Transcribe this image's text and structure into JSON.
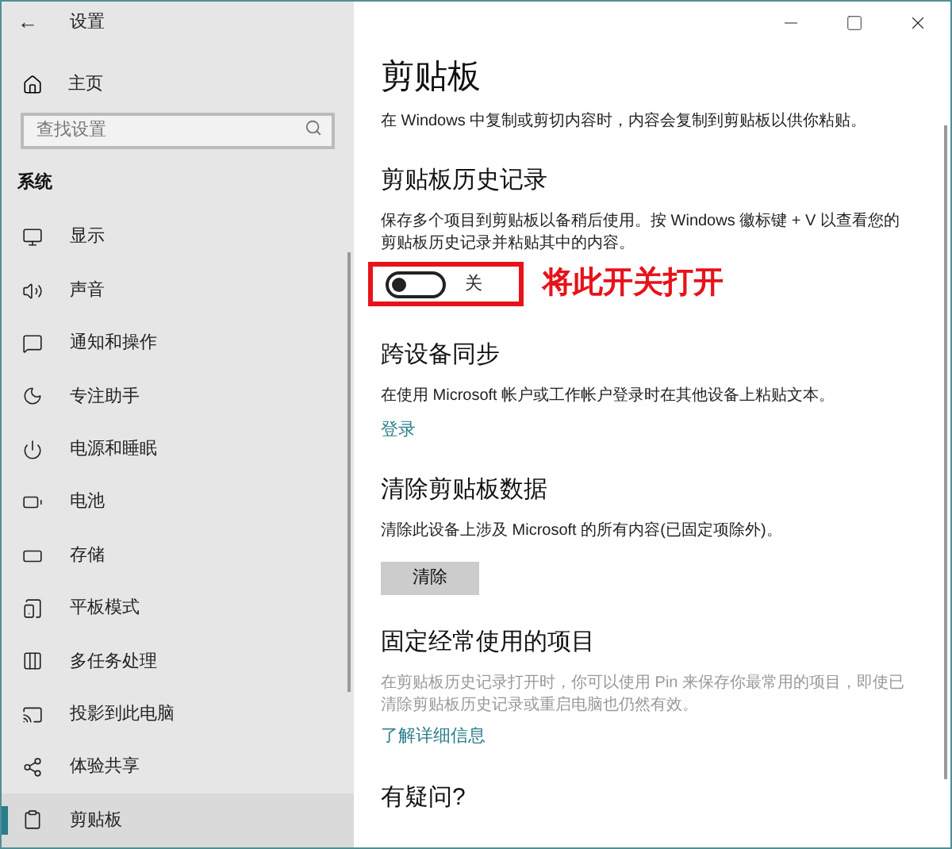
{
  "window": {
    "title": "设置",
    "back": "←"
  },
  "sidebar": {
    "home": "主页",
    "search": {
      "placeholder": "查找设置"
    },
    "section": "系统",
    "items": [
      {
        "label": "显示",
        "selected": false
      },
      {
        "label": "声音",
        "selected": false
      },
      {
        "label": "通知和操作",
        "selected": false
      },
      {
        "label": "专注助手",
        "selected": false
      },
      {
        "label": "电源和睡眠",
        "selected": false
      },
      {
        "label": "电池",
        "selected": false
      },
      {
        "label": "存储",
        "selected": false
      },
      {
        "label": "平板模式",
        "selected": false
      },
      {
        "label": "多任务处理",
        "selected": false
      },
      {
        "label": "投影到此电脑",
        "selected": false
      },
      {
        "label": "体验共享",
        "selected": false
      },
      {
        "label": "剪贴板",
        "selected": true
      }
    ]
  },
  "page": {
    "title": "剪贴板",
    "intro": "在 Windows 中复制或剪切内容时，内容会复制到剪贴板以供你粘贴。",
    "sections": [
      {
        "kind": "toggle",
        "heading": "剪贴板历史记录",
        "text": "保存多个项目到剪贴板以备稍后使用。按 Windows 徽标键 + V 以查看您的剪贴板历史记录并粘贴其中的内容。",
        "on": false,
        "state_label": "关",
        "annotation": "将此开关打开"
      },
      {
        "kind": "link",
        "heading": "跨设备同步",
        "text": "在使用 Microsoft 帐户或工作帐户登录时在其他设备上粘贴文本。",
        "link": "登录"
      },
      {
        "kind": "button",
        "heading": "清除剪贴板数据",
        "text": "清除此设备上涉及 Microsoft 的所有内容(已固定项除外)。",
        "button": "清除"
      },
      {
        "kind": "muted",
        "heading": "固定经常使用的项目",
        "text": "在剪贴板历史记录打开时，你可以使用 Pin 来保存你最常用的项目，即使已清除剪贴板历史记录或重启电脑也仍然有效。",
        "link": "了解详细信息"
      },
      {
        "kind": "heading",
        "heading": "有疑问?"
      }
    ]
  }
}
